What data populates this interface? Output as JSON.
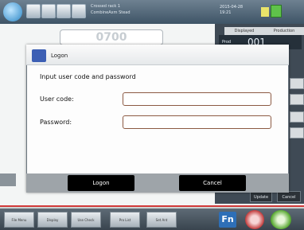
{
  "topbar": {
    "header_text": "Crossed rack 1\nCombineAxm Stead",
    "datetime": "2015-04-28\n19:21"
  },
  "background": {
    "number_display": "0700",
    "right_tabs": [
      "Displayed",
      "Production"
    ],
    "right_label": "Prod",
    "right_value": "001",
    "update_label": "Update",
    "cancel_label": "Cancel"
  },
  "bottombar": {
    "buttons": [
      "File Menu",
      "Display",
      "Use Check",
      "Pro List",
      "Set Ant"
    ],
    "fn_label": "Fn"
  },
  "dialog": {
    "title": "Logon",
    "prompt": "Input user  code and password",
    "user_code_label": "User code:",
    "password_label": "Password:",
    "user_code_value": "",
    "password_value": "",
    "logon_button": "Logon",
    "cancel_button": "Cancel"
  }
}
